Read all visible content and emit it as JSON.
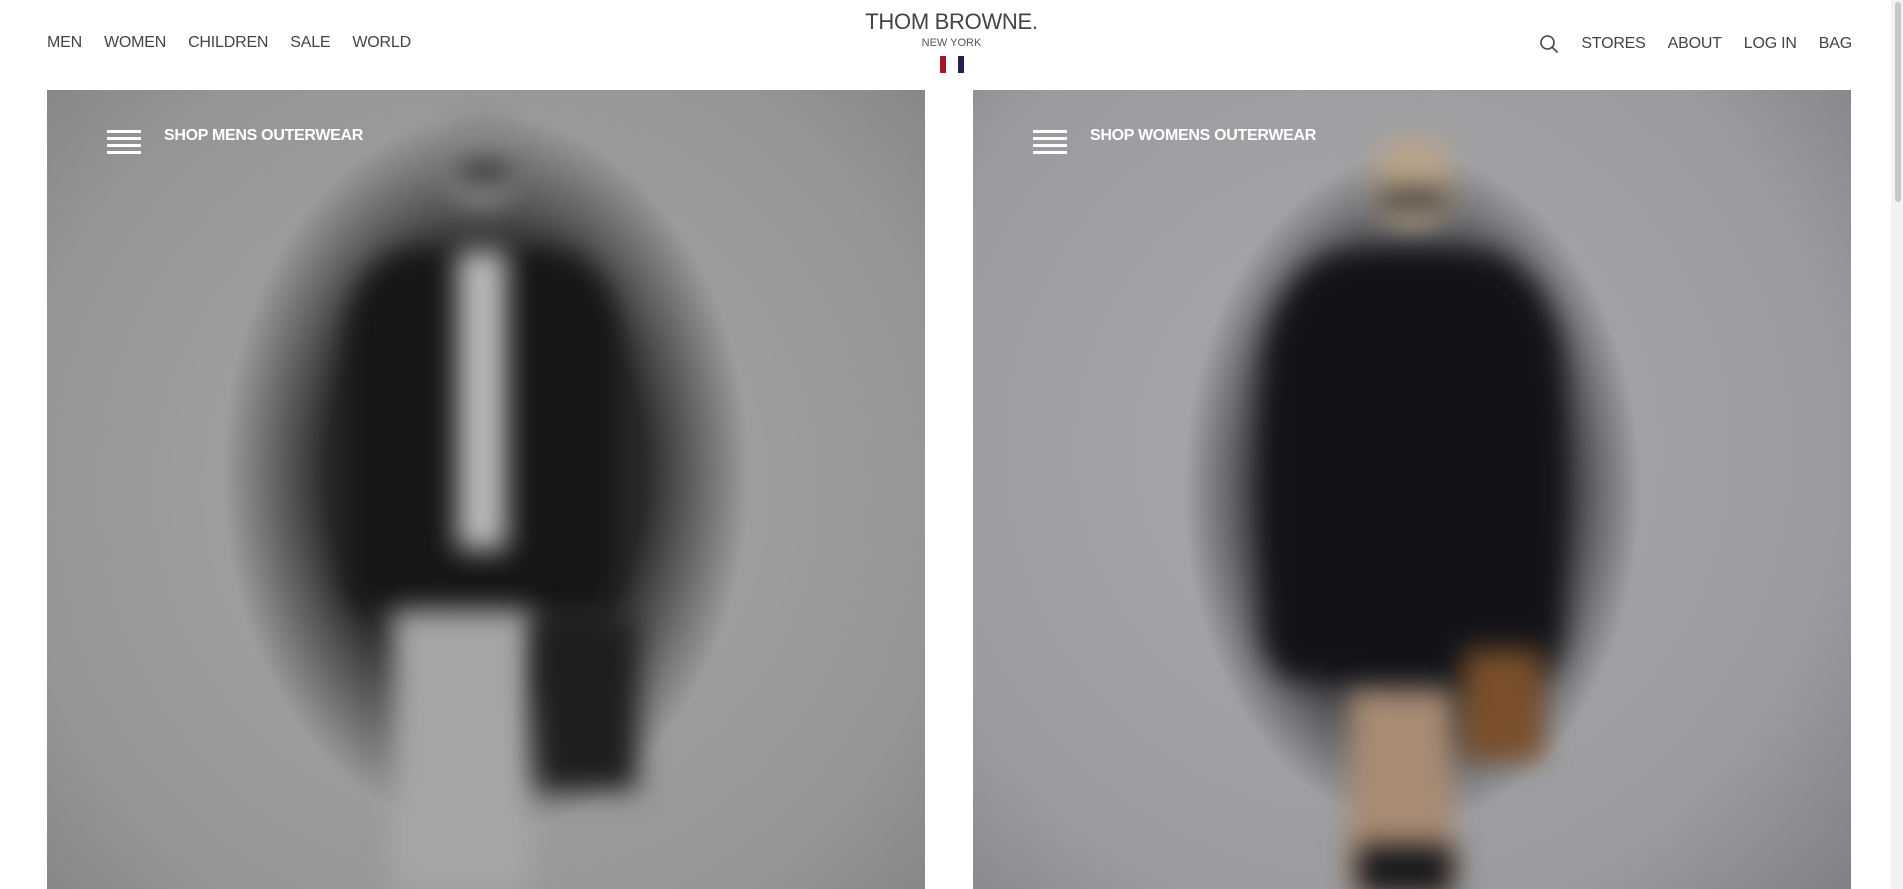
{
  "header": {
    "nav_left": [
      "MEN",
      "WOMEN",
      "CHILDREN",
      "SALE",
      "WORLD"
    ],
    "nav_right": [
      "STORES",
      "ABOUT",
      "LOG IN",
      "BAG"
    ],
    "search_icon": "search-icon",
    "brand": "THOM BROWNE.",
    "city": "NEW YORK",
    "flag_colors": [
      "#a3162c",
      "#ffffff",
      "#1f2452"
    ]
  },
  "panels": [
    {
      "label": "SHOP MENS OUTERWEAR",
      "icon": "menu-icon"
    },
    {
      "label": "SHOP WOMENS OUTERWEAR",
      "icon": "menu-icon"
    }
  ]
}
